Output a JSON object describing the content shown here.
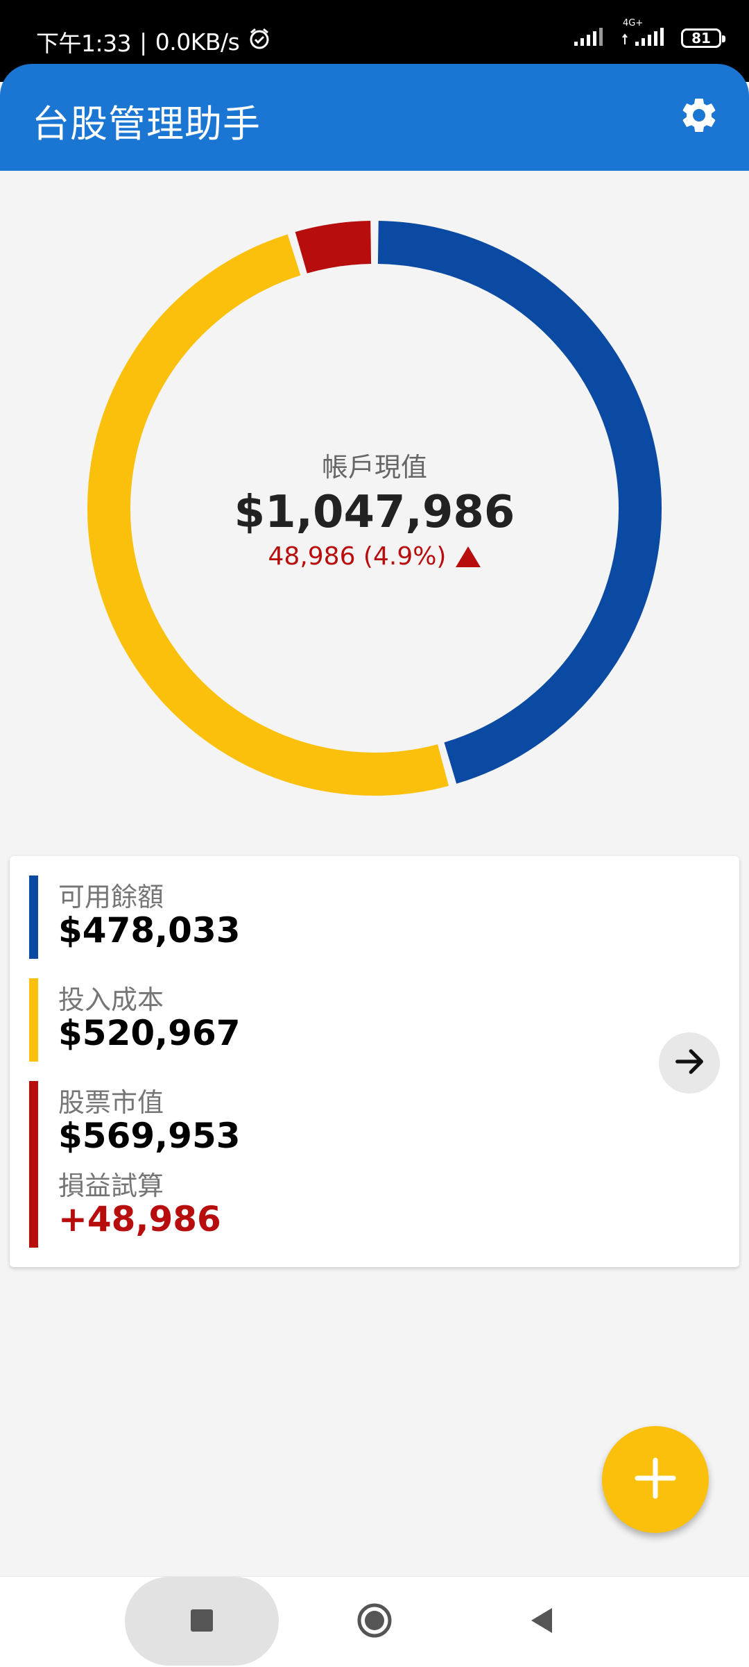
{
  "status_bar": {
    "time": "下午1:33",
    "speed": "0.0KB/s",
    "network": "4G+",
    "battery": "81"
  },
  "app_bar": {
    "title": "台股管理助手",
    "settings_icon": "gear-icon"
  },
  "overview": {
    "label": "帳戶現值",
    "value": "$1,047,986",
    "change": "48,986 (4.9%)",
    "change_icon": "triangle-up-icon",
    "donut": {
      "segments": [
        {
          "name": "可用餘額",
          "amount": 478033,
          "color": "#0b4aa2"
        },
        {
          "name": "投入成本",
          "amount": 520967,
          "color": "#fbc00c"
        },
        {
          "name": "損益試算",
          "amount": 48986,
          "color": "#b80d0d"
        }
      ]
    }
  },
  "summary": {
    "available": {
      "label": "可用餘額",
      "value": "$478,033",
      "color": "#0b4aa2"
    },
    "cost": {
      "label": "投入成本",
      "value": "$520,967",
      "color": "#fbc00c"
    },
    "market": {
      "label": "股票市值",
      "value": "$569,953",
      "color": "#b80d0d"
    },
    "profit": {
      "label": "損益試算",
      "value": "+48,986"
    },
    "arrow_icon": "arrow-right-icon"
  },
  "fab": {
    "icon": "plus-icon"
  },
  "nav": {
    "recent_icon": "square-icon",
    "home_icon": "circle-icon",
    "back_icon": "back-triangle-icon"
  }
}
